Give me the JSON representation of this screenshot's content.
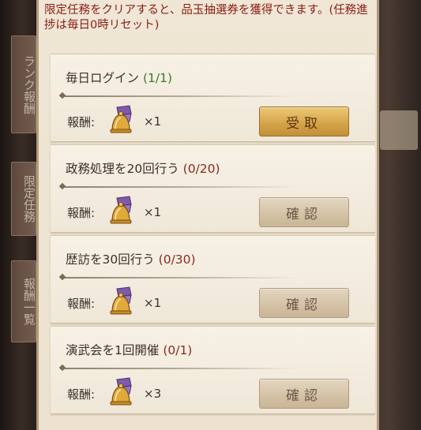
{
  "notice": "限定任務をクリアすると、品玉抽選券を獲得できます。(任務進捗は毎日0時リセット)",
  "side_tabs": [
    "ランク報酬",
    "限定任務",
    "報酬一覧"
  ],
  "tasks": [
    {
      "title": "毎日ログイン",
      "progress": "(1/1)",
      "completed": true,
      "reward_label": "報酬:",
      "reward_icon": "lottery-ticket-icon",
      "reward_qty": "×1",
      "button_label": "受取"
    },
    {
      "title": "政務処理を20回行う",
      "progress": "(0/20)",
      "completed": false,
      "reward_label": "報酬:",
      "reward_icon": "lottery-ticket-icon",
      "reward_qty": "×1",
      "button_label": "確認"
    },
    {
      "title": "歴訪を30回行う",
      "progress": "(0/30)",
      "completed": false,
      "reward_label": "報酬:",
      "reward_icon": "lottery-ticket-icon",
      "reward_qty": "×1",
      "button_label": "確認"
    },
    {
      "title": "演武会を1回開催",
      "progress": "(0/1)",
      "completed": false,
      "reward_label": "報酬:",
      "reward_icon": "lottery-ticket-icon",
      "reward_qty": "×3",
      "button_label": "確認"
    }
  ],
  "colors": {
    "notice_text": "#8a1e15",
    "progress_done": "#3d7a2e",
    "progress_todo": "#8a2a1f",
    "claim_button": "#d6a54a",
    "check_button": "#d4c3a7"
  }
}
